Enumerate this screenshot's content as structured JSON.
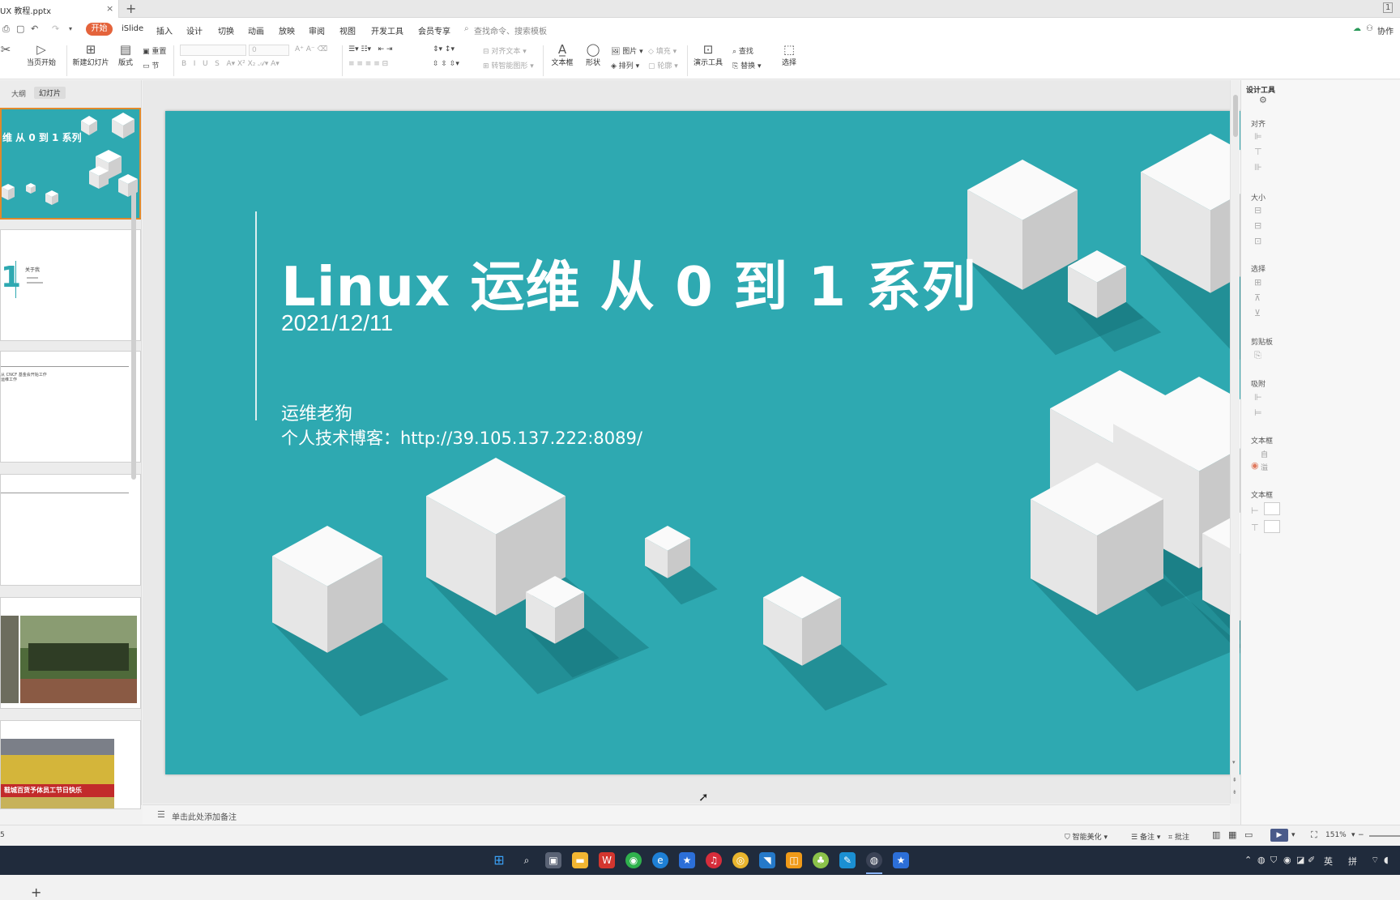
{
  "window": {
    "doc_tab": "UX 教程.pptx",
    "close": "×",
    "new_tab": "+",
    "win_button": "1"
  },
  "menu": {
    "active": "开始",
    "items": [
      "iSlide",
      "插入",
      "设计",
      "切换",
      "动画",
      "放映",
      "审阅",
      "视图",
      "开发工具",
      "会员专享"
    ],
    "search": "查找命令、搜索模板",
    "collab": "协作"
  },
  "ribbon": {
    "play_from_current": "当页开始",
    "new_slide": "新建幻灯片",
    "layout": "版式",
    "reset": "重置",
    "section": "节",
    "font_size": "0",
    "align_text": "对齐文本",
    "to_smartart": "转智能图形",
    "textbox": "文本框",
    "shape": "形状",
    "picture": "图片",
    "fill": "填充",
    "arrange": "排列",
    "outline": "轮廓",
    "present_tool": "演示工具",
    "find": "查找",
    "replace": "替换",
    "select": "选择"
  },
  "left_panel": {
    "tab_outline": "大纲",
    "tab_slides": "幻灯片",
    "thumb1_title": "维 从 0 到 1 系列",
    "thumb2_num": "1",
    "thumb2_title": "关于我",
    "thumb3_text": "从 CNCF 基金会开始工作",
    "thumb3_text2": "运维工作",
    "thumb6_banner": "鞋城百货予体员工节日快乐",
    "add": "+"
  },
  "slide": {
    "title": "Linux 运维 从 0 到 1 系列",
    "date": "2021/12/11",
    "author": "运维老狗",
    "blog": "个人技术博客：http://39.105.137.222:8089/"
  },
  "notes": {
    "placeholder": "单击此处添加备注"
  },
  "right_panel": {
    "header": "设计工具",
    "align": "对齐",
    "size": "大小",
    "select": "选择",
    "clipboard": "剪贴板",
    "snap": "吸附",
    "textbox": "文本框",
    "textbox2": "文本框",
    "opt1": "自",
    "opt2": "溢"
  },
  "status": {
    "left": "5",
    "smart_beautify": "智能美化",
    "notes": "备注",
    "comments": "批注",
    "zoom": "151%"
  },
  "taskbar": {
    "ime_lang": "英",
    "ime_mode": "拼"
  },
  "colors": {
    "slide_bg": "#2ea9b1",
    "accent": "#e4633b",
    "taskbar": "#202b3c",
    "selection": "#e08a2c"
  }
}
